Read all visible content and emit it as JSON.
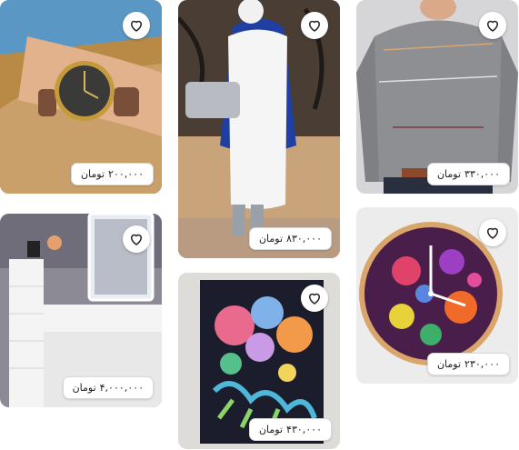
{
  "products": [
    {
      "image": "wristwatch-photo",
      "price": "۲۰۰,۰۰۰",
      "currency": "تومان"
    },
    {
      "image": "womens-coat-outfit-photo",
      "price": "۸۳۰,۰۰۰",
      "currency": "تومان"
    },
    {
      "image": "grey-sweater-photo",
      "price": "۳۳۰,۰۰۰",
      "currency": "تومان"
    },
    {
      "image": "white-vanity-desk-photo",
      "price": "۴,۰۰۰,۰۰۰",
      "currency": "تومان"
    },
    {
      "image": "floral-painting-photo",
      "price": "۴۳۰,۰۰۰",
      "currency": "تومان"
    },
    {
      "image": "floral-wall-clock-photo",
      "price": "۲۳۰,۰۰۰",
      "currency": "تومان"
    }
  ],
  "icons": {
    "favorite": "heart-outline-icon"
  },
  "colors": {
    "card_bg": "#eeeeee",
    "badge_border": "#d9d9d9",
    "text": "#222222"
  }
}
